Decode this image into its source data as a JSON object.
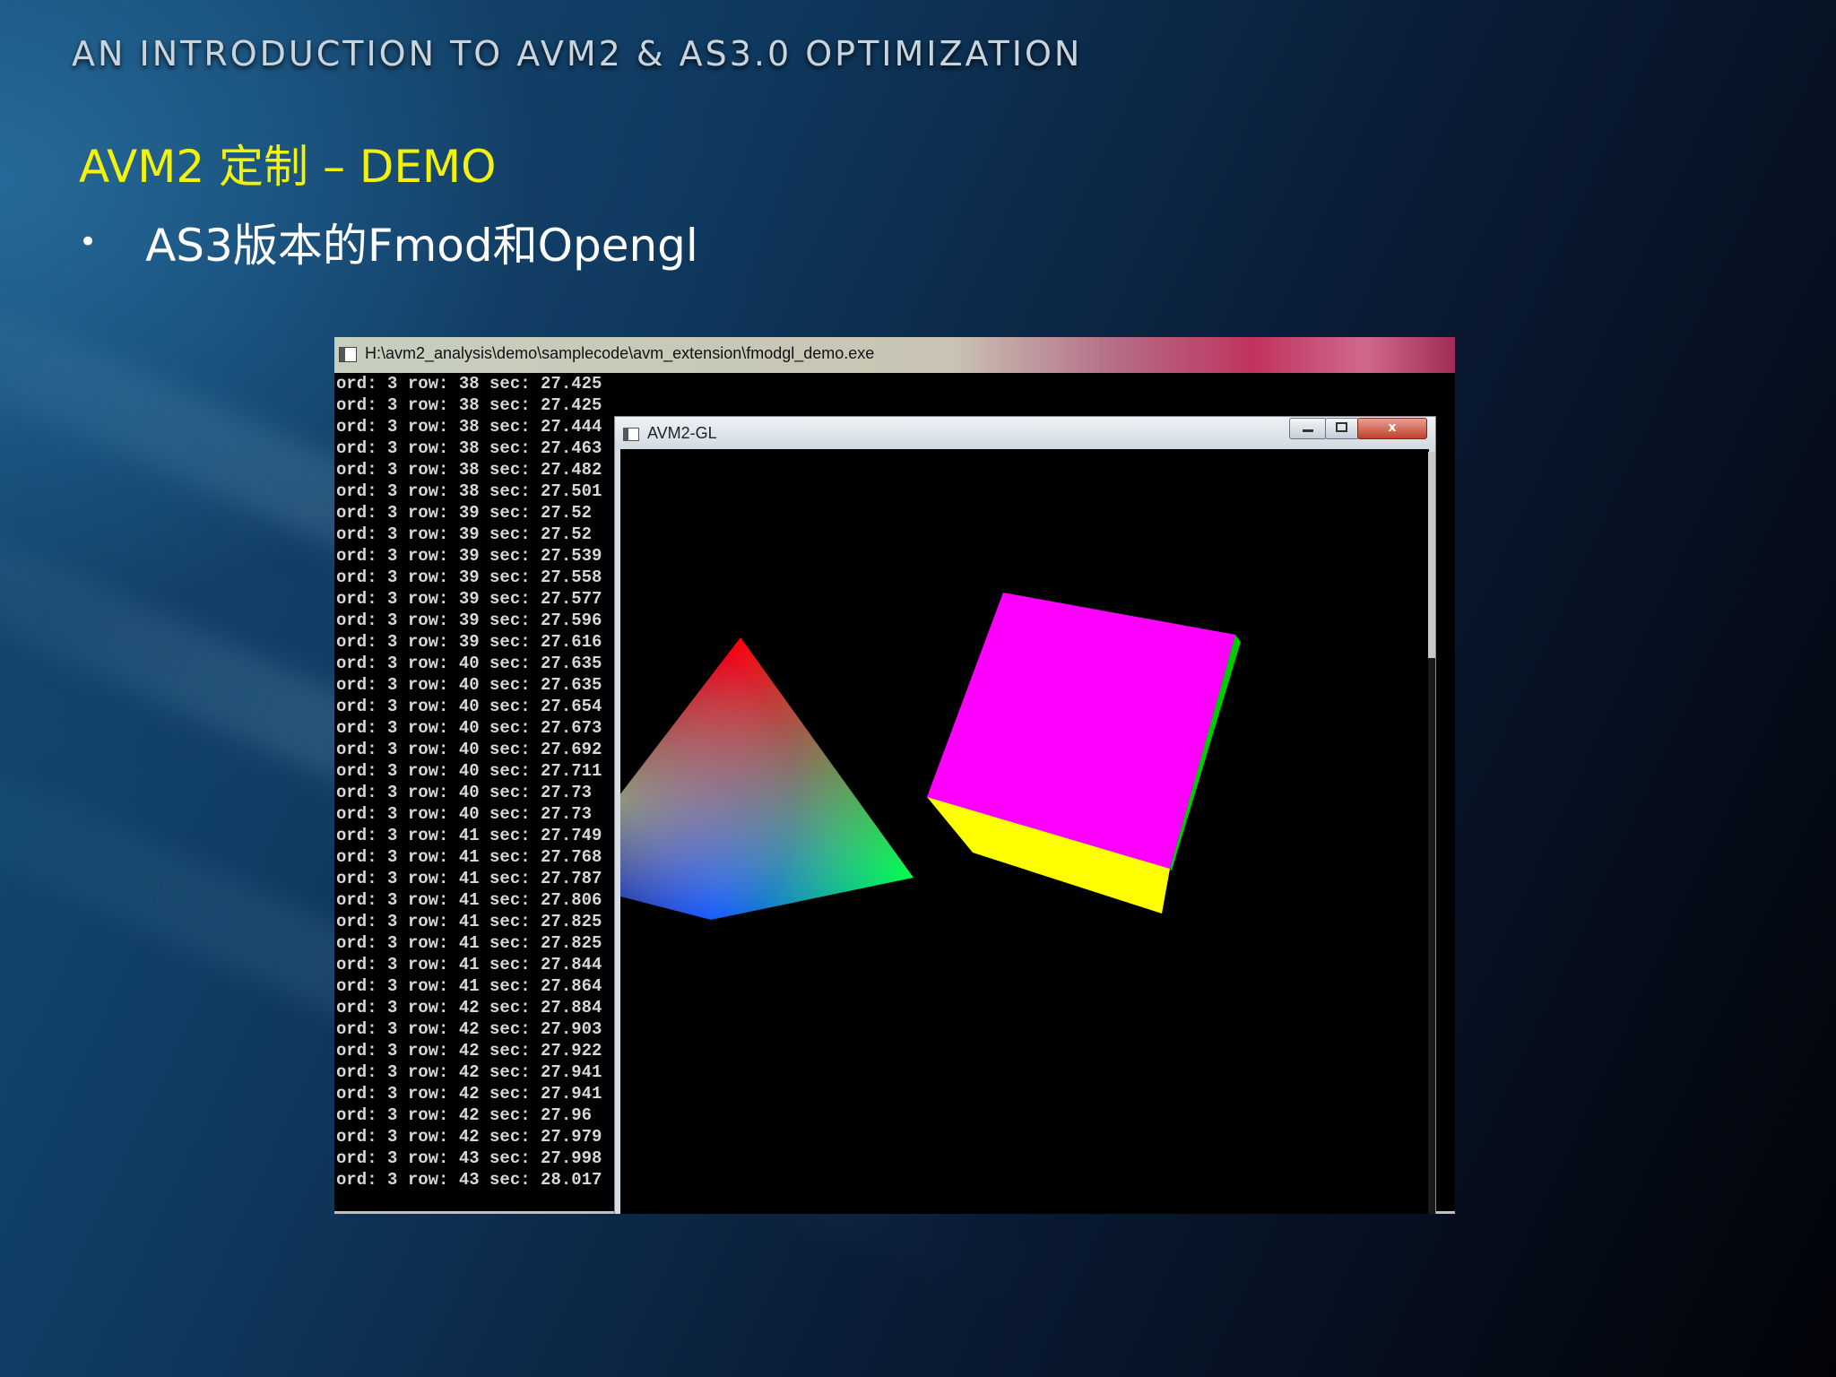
{
  "slide": {
    "header_title": "AN INTRODUCTION TO AVM2 & AS3.0 OPTIMIZATION",
    "title": "AVM2 定制 – DEMO",
    "bullet": "AS3版本的Fmod和Opengl"
  },
  "console_window": {
    "title": "H:\\avm2_analysis\\demo\\samplecode\\avm_extension\\fmodgl_demo.exe",
    "lines": [
      "ord: 3 row: 38 sec: 27.425",
      "ord: 3 row: 38 sec: 27.425",
      "ord: 3 row: 38 sec: 27.444",
      "ord: 3 row: 38 sec: 27.463",
      "ord: 3 row: 38 sec: 27.482",
      "ord: 3 row: 38 sec: 27.501",
      "ord: 3 row: 39 sec: 27.52",
      "ord: 3 row: 39 sec: 27.52",
      "ord: 3 row: 39 sec: 27.539",
      "ord: 3 row: 39 sec: 27.558",
      "ord: 3 row: 39 sec: 27.577",
      "ord: 3 row: 39 sec: 27.596",
      "ord: 3 row: 39 sec: 27.616",
      "ord: 3 row: 40 sec: 27.635",
      "ord: 3 row: 40 sec: 27.635",
      "ord: 3 row: 40 sec: 27.654",
      "ord: 3 row: 40 sec: 27.673",
      "ord: 3 row: 40 sec: 27.692",
      "ord: 3 row: 40 sec: 27.711",
      "ord: 3 row: 40 sec: 27.73",
      "ord: 3 row: 40 sec: 27.73",
      "ord: 3 row: 41 sec: 27.749",
      "ord: 3 row: 41 sec: 27.768",
      "ord: 3 row: 41 sec: 27.787",
      "ord: 3 row: 41 sec: 27.806",
      "ord: 3 row: 41 sec: 27.825",
      "ord: 3 row: 41 sec: 27.825",
      "ord: 3 row: 41 sec: 27.844",
      "ord: 3 row: 41 sec: 27.864",
      "ord: 3 row: 42 sec: 27.884",
      "ord: 3 row: 42 sec: 27.903",
      "ord: 3 row: 42 sec: 27.922",
      "ord: 3 row: 42 sec: 27.941",
      "ord: 3 row: 42 sec: 27.941",
      "ord: 3 row: 42 sec: 27.96",
      "ord: 3 row: 42 sec: 27.979",
      "ord: 3 row: 43 sec: 27.998",
      "ord: 3 row: 43 sec: 28.017"
    ]
  },
  "gl_window": {
    "title": "AVM2-GL",
    "minimize_icon": "minimize-icon",
    "maximize_icon": "maximize-icon",
    "close_icon": "close-icon",
    "close_glyph": "x",
    "colors": {
      "pyramid": [
        "#ff0000",
        "#00ff00",
        "#0000ff"
      ],
      "cube_top": "#ff00ff",
      "cube_bottom": "#ffff00",
      "cube_side": "#00cc00"
    }
  }
}
